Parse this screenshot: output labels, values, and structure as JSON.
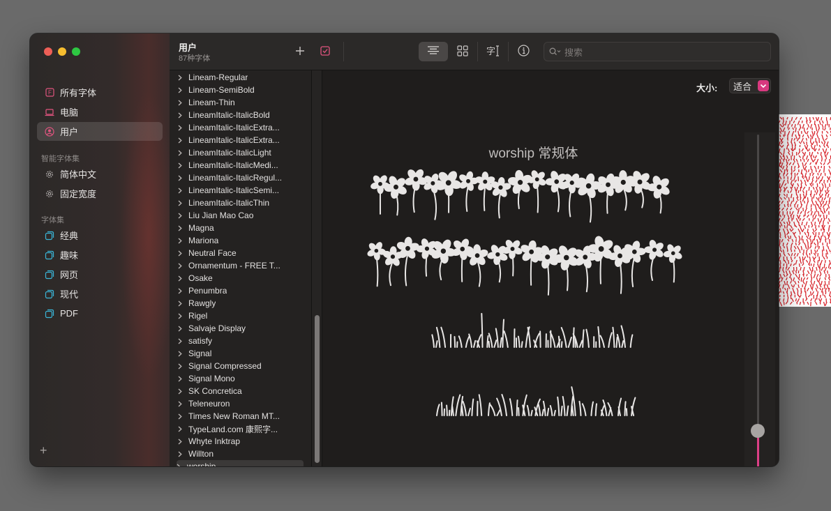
{
  "sidebar": {
    "items": [
      {
        "label": "所有字体",
        "icon": "font-book-icon"
      },
      {
        "label": "电脑",
        "icon": "laptop-icon"
      },
      {
        "label": "用户",
        "icon": "user-circle-icon"
      }
    ],
    "smart_group_label": "智能字体集",
    "smart_items": [
      {
        "label": "简体中文",
        "icon": "gear-icon"
      },
      {
        "label": "固定宽度",
        "icon": "gear-icon"
      }
    ],
    "collections_label": "字体集",
    "collections": [
      {
        "label": "经典",
        "icon": "collection-icon"
      },
      {
        "label": "趣味",
        "icon": "collection-icon"
      },
      {
        "label": "网页",
        "icon": "collection-icon"
      },
      {
        "label": "现代",
        "icon": "collection-icon"
      },
      {
        "label": "PDF",
        "icon": "collection-icon"
      }
    ],
    "add_label": "+"
  },
  "toolbar": {
    "title": "用户",
    "subtitle": "87种字体",
    "add_icon": "plus-icon",
    "validate_icon": "checkbox-icon",
    "view_icons": [
      "text-align-icon",
      "grid-icon",
      "text-cursor-icon",
      "info-icon"
    ],
    "search_placeholder": "搜索"
  },
  "fonts": [
    "Lineam-Regular",
    "Lineam-SemiBold",
    "Lineam-Thin",
    "LineamItalic-ItalicBold",
    "LineamItalic-ItalicExtra...",
    "LineamItalic-ItalicExtra...",
    "LineamItalic-ItalicLight",
    "LineamItalic-ItalicMedi...",
    "LineamItalic-ItalicRegul...",
    "LineamItalic-ItalicSemi...",
    "LineamItalic-ItalicThin",
    "Liu Jian Mao Cao",
    "Magna",
    "Mariona",
    "Neutral Face",
    "Ornamentum - FREE T...",
    "Osake",
    "Penumbra",
    "Rawgly",
    "Rigel",
    "Salvaje Display",
    "satisfy",
    "Signal",
    "Signal Compressed",
    "Signal Mono",
    "SK Concretica",
    "Teleneuron",
    "Times New Roman MT...",
    "TypeLand.com 康熙字...",
    "Whyte Inktrap",
    "Willton",
    "worship"
  ],
  "selected_font": "worship",
  "preview": {
    "size_label": "大小:",
    "size_value": "适合",
    "sample_title": "worship 常规体",
    "size_slider_level": 0.16
  },
  "colors": {
    "accent": "#dc3f86",
    "window_bg": "#252322",
    "sidebar_bg": "#2c2928"
  }
}
